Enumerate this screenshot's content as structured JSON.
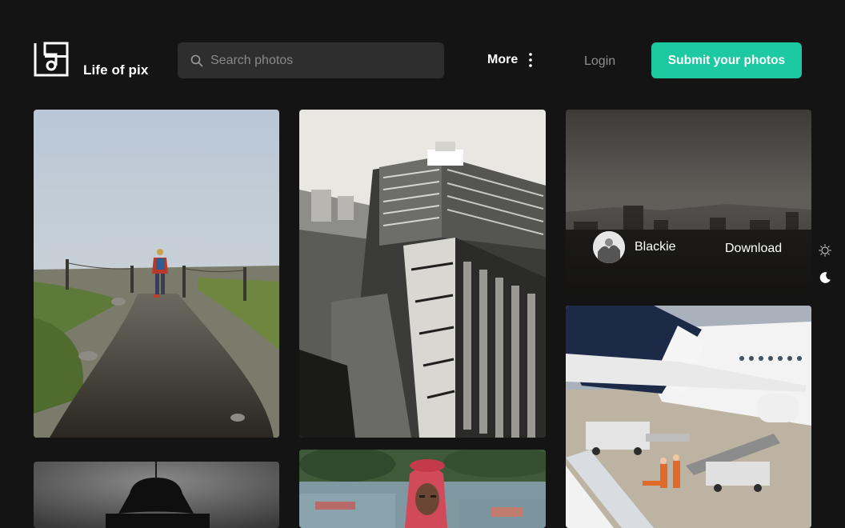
{
  "brand": {
    "name": "Life of pix"
  },
  "search": {
    "placeholder": "Search photos",
    "value": ""
  },
  "nav": {
    "more_label": "More",
    "login_label": "Login",
    "submit_label": "Submit your photos"
  },
  "theme": {
    "light_icon": "sun-icon",
    "dark_icon": "moon-icon"
  },
  "colors": {
    "accent": "#1cc9a1",
    "background": "#141414",
    "search_bg": "#2e2e2e"
  },
  "photos": [
    {
      "subject": "foggy-trail-hiker"
    },
    {
      "subject": "city-building-black-white"
    },
    {
      "subject": "foggy-city-skyline",
      "author": "Blackie",
      "action": "Download"
    },
    {
      "subject": "airplane-ground-crew"
    },
    {
      "subject": "hat-silhouette"
    },
    {
      "subject": "man-red-hood"
    }
  ]
}
